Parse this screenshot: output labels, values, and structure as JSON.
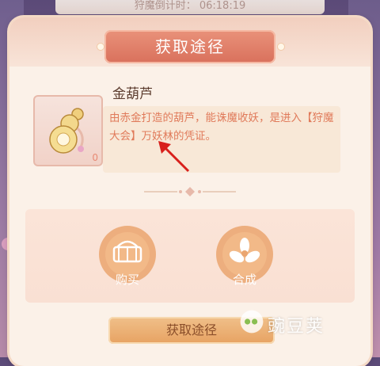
{
  "timer": {
    "text": "狩魔倒计时： 06:18:19"
  },
  "dialog": {
    "title": "获取途径"
  },
  "item": {
    "name": "金葫芦",
    "count": "0",
    "description": "由赤金打造的葫芦，能诛魔收妖，是进入【狩魔大会】万妖林的凭证。"
  },
  "sources": [
    {
      "label": "购买",
      "icon": "shopping-basket-icon"
    },
    {
      "label": "合成",
      "icon": "flower-craft-icon"
    }
  ],
  "bottom_button": {
    "label": "获取途径"
  },
  "watermark": {
    "text": "豌豆荚"
  },
  "colors": {
    "ribbon": "#d9705c",
    "description_text": "#e07a5a",
    "source_flower": "#eaa56f",
    "bottom_button": "#e7a262"
  }
}
